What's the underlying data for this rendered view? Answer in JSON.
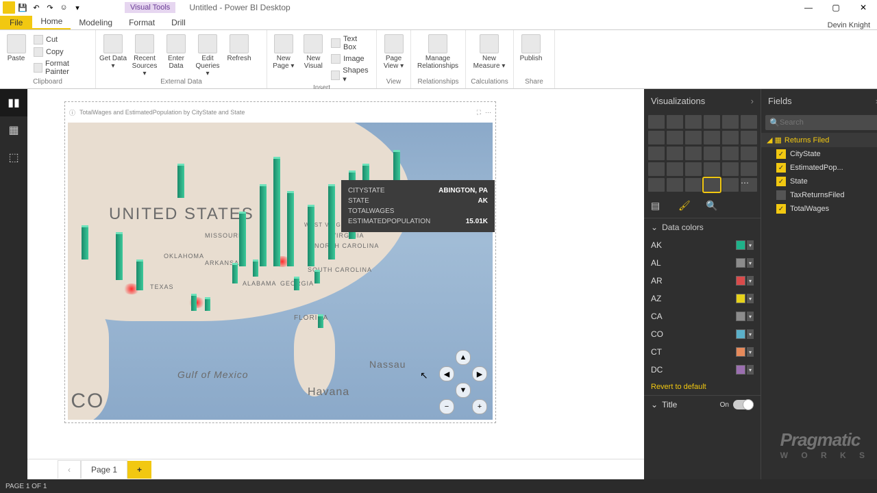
{
  "app": {
    "visual_tools": "Visual Tools",
    "title": "Untitled - Power BI Desktop",
    "username": "Devin Knight"
  },
  "tabs": {
    "file": "File",
    "items": [
      "Home",
      "Modeling",
      "Format",
      "Drill"
    ],
    "active": "Home"
  },
  "ribbon": {
    "clipboard": {
      "label": "Clipboard",
      "paste": "Paste",
      "cut": "Cut",
      "copy": "Copy",
      "format_painter": "Format Painter"
    },
    "external": {
      "label": "External Data",
      "get_data": "Get Data ▾",
      "recent": "Recent Sources ▾",
      "enter": "Enter Data",
      "edit": "Edit Queries ▾",
      "refresh": "Refresh"
    },
    "insert": {
      "label": "Insert",
      "new_page": "New Page ▾",
      "new_visual": "New Visual",
      "text_box": "Text Box",
      "image": "Image",
      "shapes": "Shapes ▾"
    },
    "view": {
      "label": "View",
      "page_view": "Page View ▾"
    },
    "relationships": {
      "label": "Relationships",
      "manage": "Manage Relationships"
    },
    "calculations": {
      "label": "Calculations",
      "new_measure": "New Measure ▾"
    },
    "share": {
      "label": "Share",
      "publish": "Publish"
    }
  },
  "visual": {
    "caption": "TotalWages and EstimatedPopulation by CityState and State",
    "map_labels": {
      "us": "UNITED STATES",
      "ico": "ICO",
      "gulf": "Gulf of Mexico",
      "nassau": "Nassau",
      "havana": "Havana",
      "florida": "FLORIDA",
      "sc": "SOUTH CAROLINA",
      "nc": "NORTH CAROLINA",
      "ga": "GEORGIA",
      "al": "ALABAMA",
      "ar": "ARKANSAS",
      "ok": "OKLAHOMA",
      "mo": "MISSOURI",
      "tx": "TEXAS",
      "va": "VIRGINIA",
      "wv": "WEST VIRGINIA"
    },
    "tooltip": {
      "k_citystate": "CITYSTATE",
      "v_citystate": "ABINGTON, PA",
      "k_state": "STATE",
      "v_state": "AK",
      "k_totalwages": "TOTALWAGES",
      "v_totalwages": "",
      "k_pop": "ESTIMATEDPOPULATION",
      "v_pop": "15.01K"
    }
  },
  "pages": {
    "page1": "Page 1",
    "add": "+"
  },
  "viz_panel": {
    "header": "Visualizations",
    "data_colors": "Data colors",
    "revert": "Revert to default",
    "title_label": "Title",
    "title_on": "On",
    "colors": [
      {
        "k": "AK",
        "c": "#1fb28a"
      },
      {
        "k": "AL",
        "c": "#8c8c8c"
      },
      {
        "k": "AR",
        "c": "#d94b4b"
      },
      {
        "k": "AZ",
        "c": "#e6d21a"
      },
      {
        "k": "CA",
        "c": "#8c8c8c"
      },
      {
        "k": "CO",
        "c": "#5bb0c9"
      },
      {
        "k": "CT",
        "c": "#e68a5b"
      },
      {
        "k": "DC",
        "c": "#9b6fb0"
      }
    ]
  },
  "fields_panel": {
    "header": "Fields",
    "search": "Search",
    "table": "Returns Filed",
    "fields": [
      {
        "name": "CityState",
        "checked": true
      },
      {
        "name": "EstimatedPop...",
        "checked": true
      },
      {
        "name": "State",
        "checked": true
      },
      {
        "name": "TaxReturnsFiled",
        "checked": false
      },
      {
        "name": "TotalWages",
        "checked": true
      }
    ]
  },
  "status": "PAGE 1 OF 1",
  "watermark": {
    "line1": "Pragmatic",
    "line2": "W O R K S"
  }
}
